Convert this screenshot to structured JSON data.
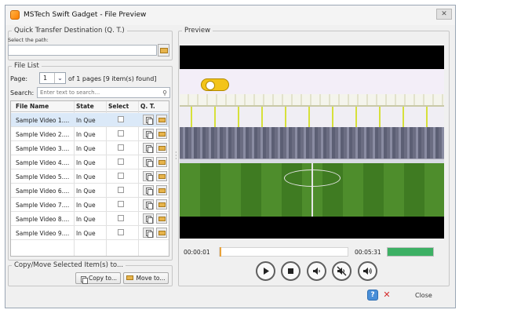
{
  "window": {
    "title": "MSTech Swift Gadget - File Preview",
    "close_glyph": "✕"
  },
  "quick_transfer": {
    "legend": "Quick Transfer Destination (Q. T.)",
    "path_label": "Select the path:",
    "path_value": ""
  },
  "file_list": {
    "legend": "File List",
    "page_label": "Page:",
    "page_value": "1",
    "page_info": "of 1 pages [9 item(s) found]",
    "search_label": "Search:",
    "search_placeholder": "Enter text to search...",
    "columns": [
      "File Name",
      "State",
      "Select",
      "Q. T."
    ],
    "rows": [
      {
        "name": "Sample Video 1....",
        "state": "In Que",
        "selected": true
      },
      {
        "name": "Sample Video 2....",
        "state": "In Que",
        "selected": false
      },
      {
        "name": "Sample Video 3....",
        "state": "In Que",
        "selected": false
      },
      {
        "name": "Sample Video 4....",
        "state": "In Que",
        "selected": false
      },
      {
        "name": "Sample Video 5....",
        "state": "In Que",
        "selected": false
      },
      {
        "name": "Sample Video 6....",
        "state": "In Que",
        "selected": false
      },
      {
        "name": "Sample Video 7....",
        "state": "In Que",
        "selected": false
      },
      {
        "name": "Sample Video 8....",
        "state": "In Que",
        "selected": false
      },
      {
        "name": "Sample Video 9....",
        "state": "In Que",
        "selected": false
      }
    ]
  },
  "copy_move": {
    "legend": "Copy/Move Selected Item(s) to...",
    "copy_label": "Copy to...",
    "move_label": "Move to..."
  },
  "preview": {
    "legend": "Preview",
    "current_time": "00:00:01",
    "total_time": "00:05:31",
    "progress": 0.003,
    "volume": 1.0,
    "controls": [
      "play-icon",
      "stop-icon",
      "volume-down-icon",
      "mute-icon",
      "volume-up-icon"
    ]
  },
  "footer": {
    "help_label": "?",
    "cancel_glyph": "✕",
    "close_label": "Close"
  },
  "colors": {
    "selected_row": "#dbe9f8",
    "volume_fill": "#3db064",
    "seek_thumb": "#e8a23a"
  }
}
